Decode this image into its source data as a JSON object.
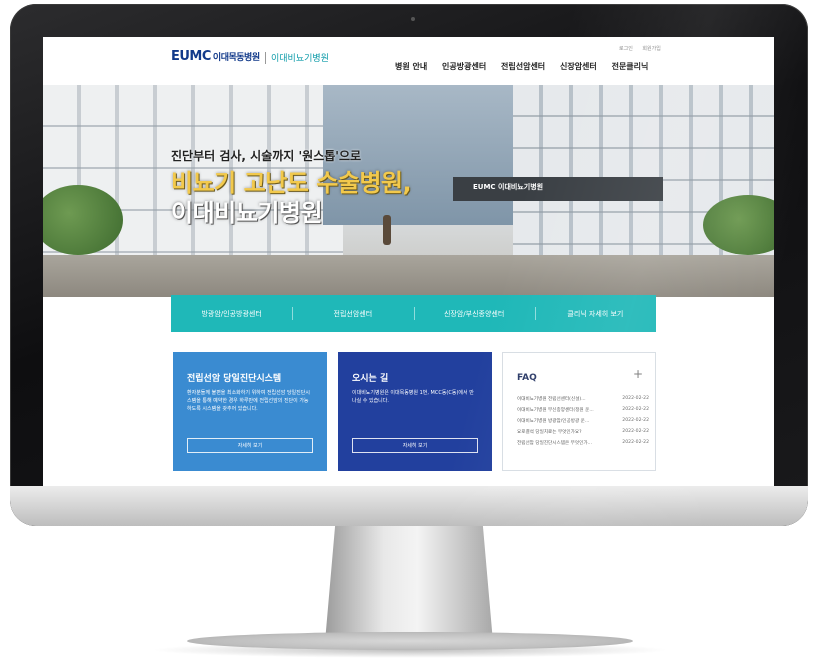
{
  "header": {
    "logo_main": "EUMC",
    "logo_hospital": "이대목동병원",
    "logo_sub": "이대비뇨기병원",
    "util_links": [
      "로그인",
      "회원가입"
    ],
    "nav": [
      "병원 안내",
      "인공방광센터",
      "전립선암센터",
      "신장암센터",
      "전문클리닉"
    ]
  },
  "hero": {
    "subtitle": "진단부터 검사, 시술까지 '원스톱'으로",
    "title_line1": "비뇨기 고난도 수술병원,",
    "title_line2": "이대비뇨기병원",
    "building_sign": "EUMC 이대비뇨기병원"
  },
  "quickbar": [
    "방광암/인공방광센터",
    "전립선암센터",
    "신장암/부신종양센터",
    "클리닉 자세히 보기"
  ],
  "cards": [
    {
      "title": "전립선암 당일진단시스템",
      "text": "환자분들께 불편을 최소화하기 위하여 전립선암 당일진단시스템을 통해 예약한 경우 하루만에 전립선암의 진단이 가능하도록 시스템을 갖추어 있습니다.",
      "button": "자세히 보기"
    },
    {
      "title": "오시는 길",
      "text": "이대비뇨기병원은 이대목동병원 1번, MCC동(C동)에서 만나실 수 있습니다.",
      "button": "자세히 보기"
    }
  ],
  "faq": {
    "title": "FAQ",
    "plus": "+",
    "items": [
      {
        "q": "이대비뇨기병원 전립선센터(신설)...",
        "d": "2022-02-22"
      },
      {
        "q": "이대비뇨기병원 부신종양센터(정원 운...",
        "d": "2022-02-22"
      },
      {
        "q": "이대비뇨기병원 방광암/인공방광 운...",
        "d": "2022-02-22"
      },
      {
        "q": "요로결석 당일치료는 무엇인가요?",
        "d": "2022-02-22"
      },
      {
        "q": "전립선암 당일진단시스템은 무엇인가...",
        "d": "2022-02-22"
      }
    ]
  }
}
